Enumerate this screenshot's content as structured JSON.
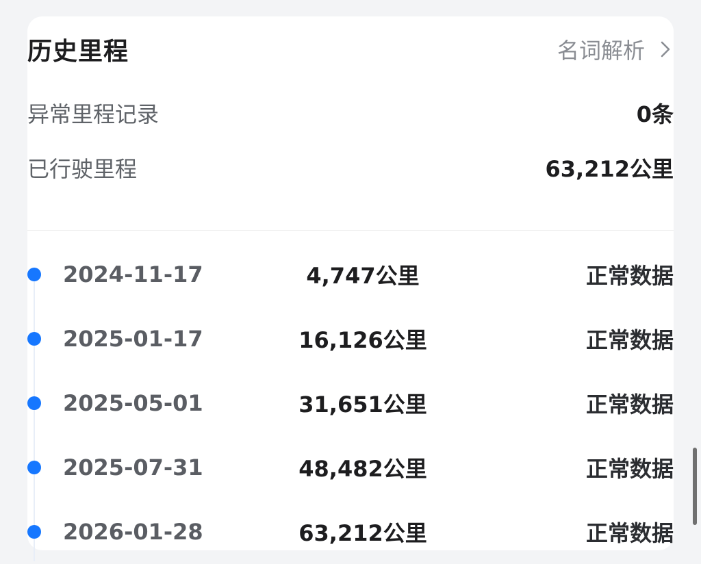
{
  "card": {
    "title": "历史里程",
    "glossary_label": "名词解析",
    "chevron_icon": "chevron-right-icon"
  },
  "stats": {
    "abnormal": {
      "label": "异常里程记录",
      "value": "0条"
    },
    "driven": {
      "label": "已行驶里程",
      "value": "63,212公里"
    }
  },
  "timeline": [
    {
      "date": "2024-11-17",
      "mileage": "4,747公里",
      "status": "正常数据"
    },
    {
      "date": "2025-01-17",
      "mileage": "16,126公里",
      "status": "正常数据"
    },
    {
      "date": "2025-05-01",
      "mileage": "31,651公里",
      "status": "正常数据"
    },
    {
      "date": "2025-07-31",
      "mileage": "48,482公里",
      "status": "正常数据"
    },
    {
      "date": "2026-01-28",
      "mileage": "63,212公里",
      "status": "正常数据"
    }
  ],
  "colors": {
    "accent": "#1677ff",
    "background": "#f3f4f6"
  }
}
